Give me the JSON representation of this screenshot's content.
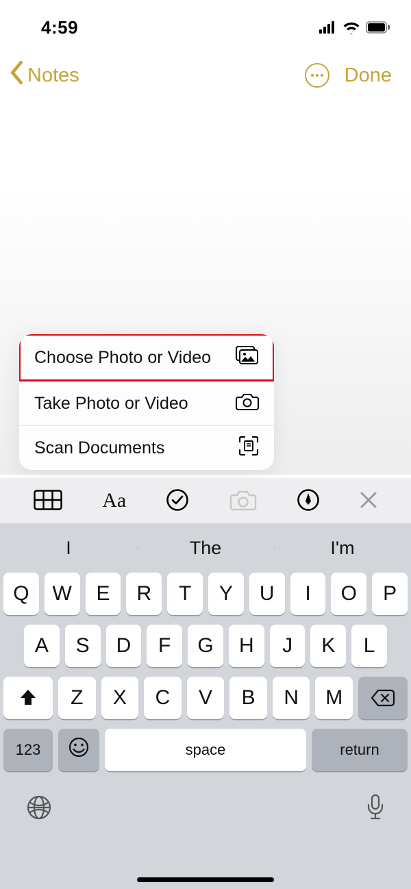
{
  "status": {
    "time": "4:59"
  },
  "nav": {
    "back_label": "Notes",
    "done_label": "Done"
  },
  "popup": {
    "items": [
      {
        "label": "Choose Photo or Video",
        "icon": "photo-library",
        "highlighted": true
      },
      {
        "label": "Take Photo or Video",
        "icon": "camera",
        "highlighted": false
      },
      {
        "label": "Scan Documents",
        "icon": "scan",
        "highlighted": false
      }
    ]
  },
  "format_bar": {
    "camera_active": true
  },
  "keyboard": {
    "suggestions": [
      "I",
      "The",
      "I'm"
    ],
    "rows": [
      [
        "Q",
        "W",
        "E",
        "R",
        "T",
        "Y",
        "U",
        "I",
        "O",
        "P"
      ],
      [
        "A",
        "S",
        "D",
        "F",
        "G",
        "H",
        "J",
        "K",
        "L"
      ],
      [
        "Z",
        "X",
        "C",
        "V",
        "B",
        "N",
        "M"
      ]
    ],
    "numeric_label": "123",
    "space_label": "space",
    "return_label": "return"
  }
}
